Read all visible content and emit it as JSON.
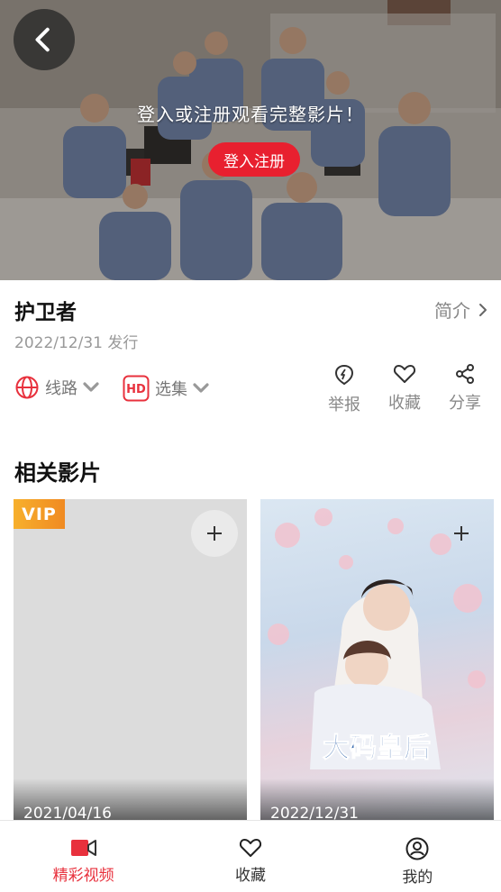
{
  "player": {
    "message": "登入或注册观看完整影片！",
    "login_label": "登入注册"
  },
  "movie": {
    "title": "护卫者",
    "intro_label": "简介",
    "release": "2022/12/31 发行"
  },
  "options": {
    "route_label": "线路",
    "episode_label": "选集",
    "hd_badge": "HD"
  },
  "actions": [
    {
      "label": "举报",
      "icon": "report-icon"
    },
    {
      "label": "收藏",
      "icon": "heart-icon"
    },
    {
      "label": "分享",
      "icon": "share-icon"
    }
  ],
  "related": {
    "title": "相关影片",
    "cards": [
      {
        "date": "2021/04/16",
        "vip": "VIP"
      },
      {
        "date": "2022/12/31",
        "poster_text": "大码皇后"
      }
    ]
  },
  "tabbar": [
    {
      "label": "精彩视频",
      "icon": "video-camera-icon",
      "active": true
    },
    {
      "label": "收藏",
      "icon": "heart-icon",
      "active": false
    },
    {
      "label": "我的",
      "icon": "user-icon",
      "active": false
    }
  ],
  "colors": {
    "accent": "#e8202f",
    "vip": "#f7b02c",
    "muted_text": "#888888"
  }
}
